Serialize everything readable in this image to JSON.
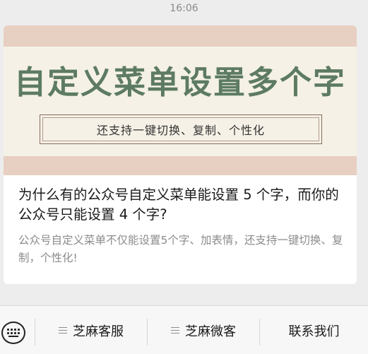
{
  "status_bar": {
    "time": "16:06"
  },
  "article": {
    "cover_title": "自定义菜单设置多个字",
    "cover_subtitle": "还支持一键切换、复制、个性化",
    "headline": "为什么有的公众号自定义菜单能设置 5 个字，而你的公众号只能设置 4 个字?",
    "digest": "公众号自定义菜单不仅能设置5个字、加表情，还支持一键切换、复制，个性化!"
  },
  "menu": {
    "keyboard_icon": "keyboard-icon",
    "items": [
      {
        "label": "芝麻客服",
        "icon": "menu-lines-icon"
      },
      {
        "label": "芝麻微客",
        "icon": "menu-lines-icon"
      },
      {
        "label": "联系我们"
      }
    ]
  },
  "colors": {
    "background": "#ededed",
    "cover": "#e7cfc2",
    "banner": "#f5f1e6",
    "title_green": "#5d7b62"
  }
}
